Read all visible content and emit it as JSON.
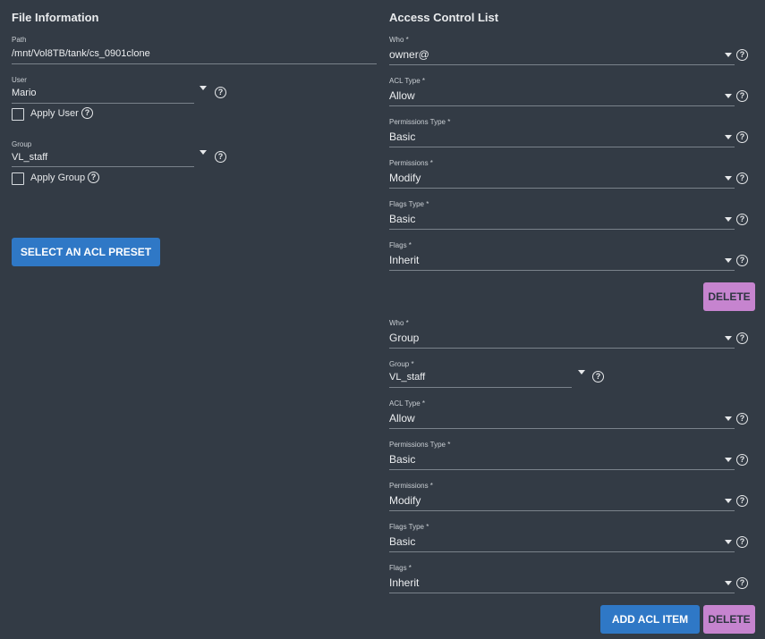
{
  "file_info": {
    "title": "File Information",
    "path": {
      "label": "Path",
      "value": "/mnt/Vol8TB/tank/cs_0901clone"
    },
    "user": {
      "label": "User",
      "value": "Mario",
      "apply_label": "Apply User"
    },
    "group": {
      "label": "Group",
      "value": "VL_staff",
      "apply_label": "Apply Group"
    },
    "preset_button": "SELECT AN ACL PRESET"
  },
  "acl": {
    "title": "Access Control List",
    "help_glyph": "?",
    "entry1": {
      "who": {
        "label": "Who *",
        "value": "owner@"
      },
      "acl_type": {
        "label": "ACL Type *",
        "value": "Allow"
      },
      "perm_type": {
        "label": "Permissions Type *",
        "value": "Basic"
      },
      "permissions": {
        "label": "Permissions *",
        "value": "Modify"
      },
      "flags_type": {
        "label": "Flags Type *",
        "value": "Basic"
      },
      "flags": {
        "label": "Flags *",
        "value": "Inherit"
      },
      "delete_label": "DELETE"
    },
    "entry2": {
      "who": {
        "label": "Who *",
        "value": "Group"
      },
      "group": {
        "label": "Group *",
        "value": "VL_staff"
      },
      "acl_type": {
        "label": "ACL Type *",
        "value": "Allow"
      },
      "perm_type": {
        "label": "Permissions Type *",
        "value": "Basic"
      },
      "permissions": {
        "label": "Permissions *",
        "value": "Modify"
      },
      "flags_type": {
        "label": "Flags Type *",
        "value": "Basic"
      },
      "flags": {
        "label": "Flags *",
        "value": "Inherit"
      },
      "delete_label": "DELETE"
    },
    "add_button": "ADD ACL ITEM"
  },
  "colors": {
    "background": "#333b45",
    "primary_button": "#2f78c6",
    "delete_button": "#c684cf"
  }
}
